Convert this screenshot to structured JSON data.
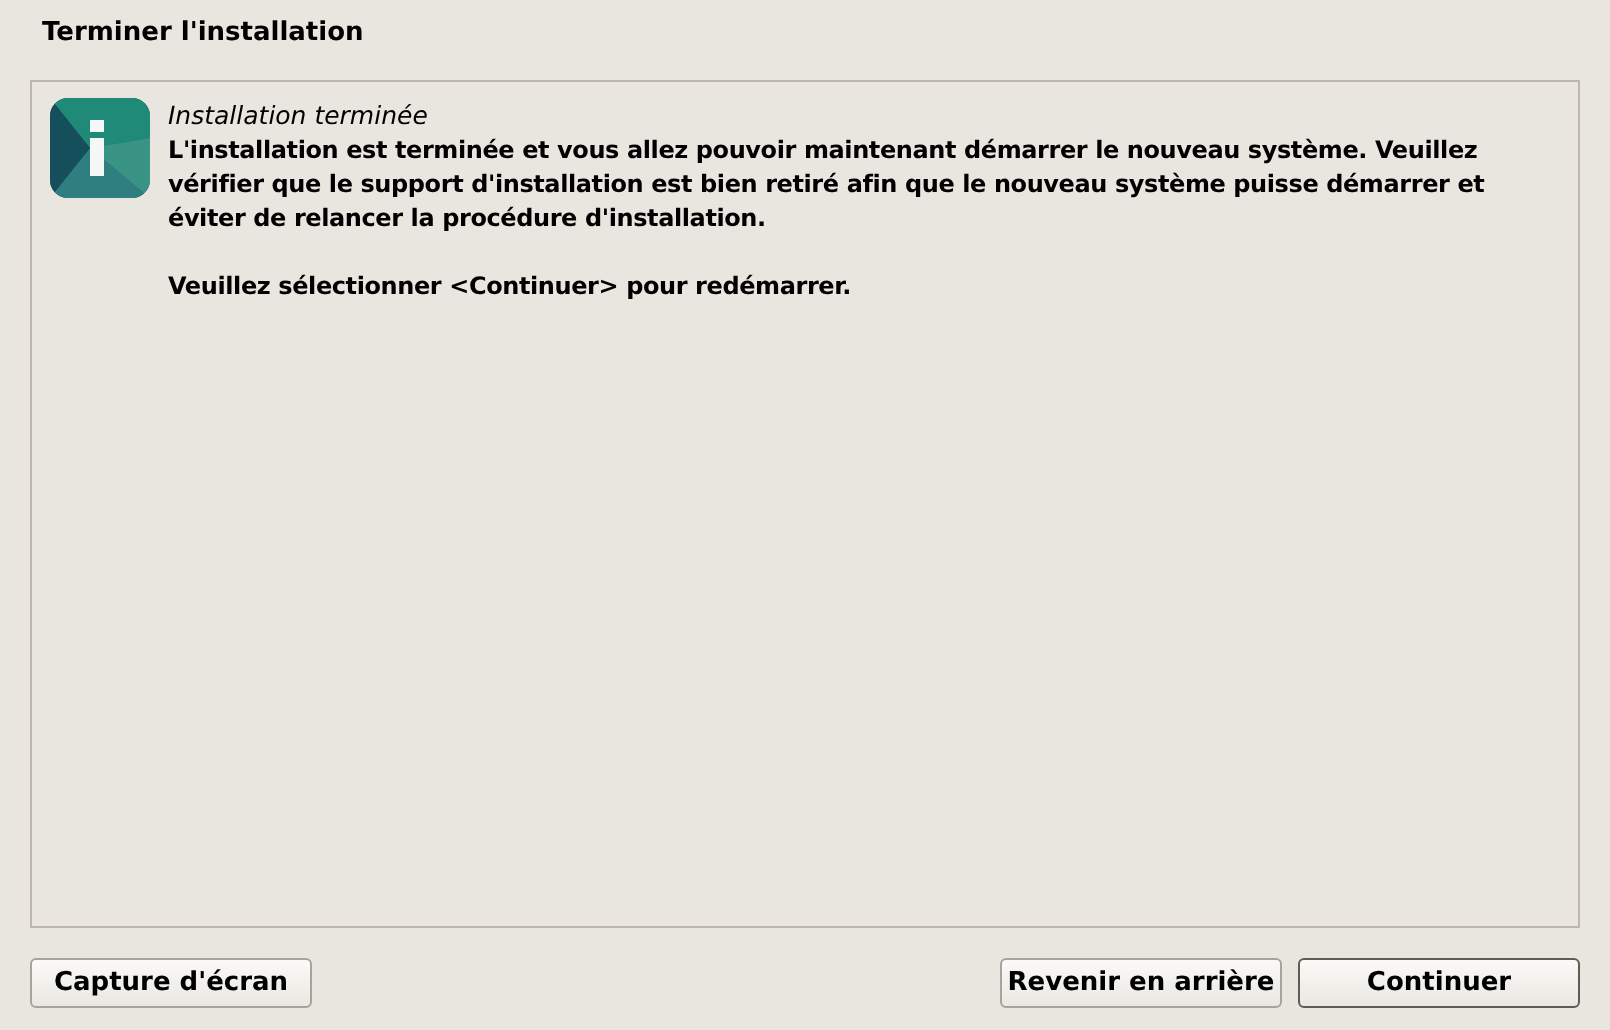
{
  "window": {
    "title": "Terminer l'installation"
  },
  "message": {
    "heading": "Installation terminée",
    "paragraphs": [
      "L'installation est terminée et vous allez pouvoir maintenant démarrer le nouveau système. Veuillez vérifier que le support d'installation est bien retiré afin que le nouveau système puisse démarrer et éviter de relancer la procédure d'installation.",
      "Veuillez sélectionner <Continuer> pour redémarrer."
    ]
  },
  "left_buttons": [
    {
      "label": "Capture d'écran",
      "default": false
    }
  ],
  "right_buttons": [
    {
      "label": "Revenir en arrière",
      "default": false
    },
    {
      "label": "Continuer",
      "default": true
    }
  ]
}
